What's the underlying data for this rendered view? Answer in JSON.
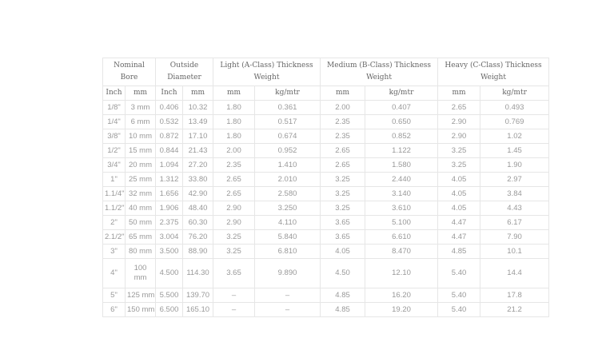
{
  "headers": {
    "nominal_bore": "Nominal Bore",
    "outside_diameter": "Outside Diameter",
    "light": "Light (A-Class) Thickness Weight",
    "medium": "Medium (B-Class) Thickness Weight",
    "heavy": "Heavy (C-Class) Thickness Weight",
    "sub": [
      "Inch",
      "mm",
      "Inch",
      "mm",
      "mm",
      "kg/mtr",
      "mm",
      "kg/mtr",
      "mm",
      "kg/mtr"
    ]
  },
  "rows": [
    [
      "1/8\"",
      "3 mm",
      "0.406",
      "10.32",
      "1.80",
      "0.361",
      "2.00",
      "0.407",
      "2.65",
      "0.493"
    ],
    [
      "1/4\"",
      "6 mm",
      "0.532",
      "13.49",
      "1.80",
      "0.517",
      "2.35",
      "0.650",
      "2.90",
      "0.769"
    ],
    [
      "3/8\"",
      "10 mm",
      "0.872",
      "17.10",
      "1.80",
      "0.674",
      "2.35",
      "0.852",
      "2.90",
      "1.02"
    ],
    [
      "1/2\"",
      "15 mm",
      "0.844",
      "21.43",
      "2.00",
      "0.952",
      "2.65",
      "1.122",
      "3.25",
      "1.45"
    ],
    [
      "3/4\"",
      "20 mm",
      "1.094",
      "27.20",
      "2.35",
      "1.410",
      "2.65",
      "1.580",
      "3.25",
      "1.90"
    ],
    [
      "1\"",
      "25 mm",
      "1.312",
      "33.80",
      "2.65",
      "2.010",
      "3.25",
      "2.440",
      "4.05",
      "2.97"
    ],
    [
      "1.1/4\"",
      "32 mm",
      "1.656",
      "42.90",
      "2.65",
      "2.580",
      "3.25",
      "3.140",
      "4.05",
      "3.84"
    ],
    [
      "1.1/2\"",
      "40 mm",
      "1.906",
      "48.40",
      "2.90",
      "3.250",
      "3.25",
      "3.610",
      "4.05",
      "4.43"
    ],
    [
      "2\"",
      "50 mm",
      "2.375",
      "60.30",
      "2.90",
      "4.110",
      "3.65",
      "5.100",
      "4.47",
      "6.17"
    ],
    [
      "2.1/2\"",
      "65 mm",
      "3.004",
      "76.20",
      "3.25",
      "5.840",
      "3.65",
      "6.610",
      "4.47",
      "7.90"
    ],
    [
      "3\"",
      "80 mm",
      "3.500",
      "88.90",
      "3.25",
      "6.810",
      "4.05",
      "8.470",
      "4.85",
      "10.1"
    ],
    [
      "4\"",
      "100 mm",
      "4.500",
      "114.30",
      "3.65",
      "9.890",
      "4.50",
      "12.10",
      "5.40",
      "14.4"
    ],
    [
      "5\"",
      "125 mm",
      "5.500",
      "139.70",
      "–",
      "–",
      "4.85",
      "16.20",
      "5.40",
      "17.8"
    ],
    [
      "6\"",
      "150 mm",
      "6.500",
      "165.10",
      "–",
      "–",
      "4.85",
      "19.20",
      "5.40",
      "21.2"
    ]
  ]
}
